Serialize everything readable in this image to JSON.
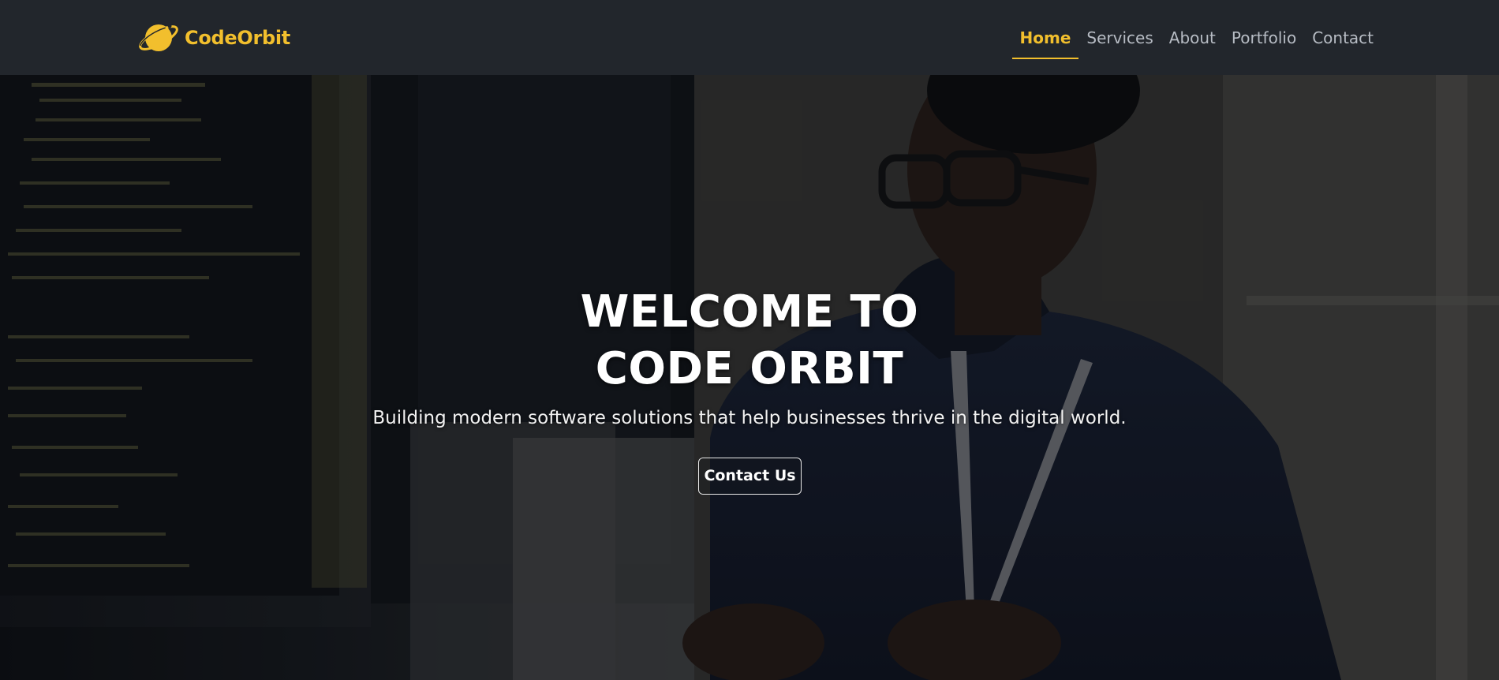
{
  "brand": {
    "name": "CodeOrbit",
    "logo_icon": "planet-icon",
    "accent_color": "#f2bf2d"
  },
  "nav": {
    "items": [
      {
        "label": "Home",
        "active": true
      },
      {
        "label": "Services",
        "active": false
      },
      {
        "label": "About",
        "active": false
      },
      {
        "label": "Portfolio",
        "active": false
      },
      {
        "label": "Contact",
        "active": false
      }
    ]
  },
  "hero": {
    "title_line1": "WELCOME TO",
    "title_line2": "CODE ORBIT",
    "subtitle": "Building modern software solutions that help businesses thrive in the digital world.",
    "cta_label": "Contact Us"
  }
}
